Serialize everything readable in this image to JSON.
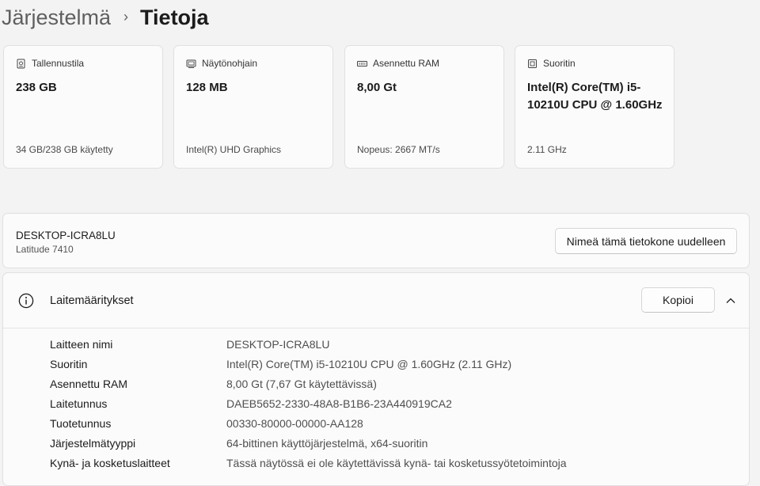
{
  "breadcrumb": {
    "parent": "Järjestelmä",
    "separator": "›",
    "current": "Tietoja"
  },
  "cards": [
    {
      "icon": "storage-icon",
      "title": "Tallennustila",
      "value": "238 GB",
      "sub": "34 GB/238 GB käytetty"
    },
    {
      "icon": "display-adapter-icon",
      "title": "Näytönohjain",
      "value": "128 MB",
      "sub": "Intel(R) UHD Graphics"
    },
    {
      "icon": "ram-icon",
      "title": "Asennettu RAM",
      "value": "8,00 Gt",
      "sub": "Nopeus: 2667 MT/s"
    },
    {
      "icon": "processor-icon",
      "title": "Suoritin",
      "value": "Intel(R) Core(TM) i5-10210U CPU @ 1.60GHz",
      "sub": "2.11 GHz"
    }
  ],
  "device": {
    "name": "DESKTOP-ICRA8LU",
    "model": "Latitude 7410",
    "rename_label": "Nimeä tämä tietokone uudelleen"
  },
  "specs": {
    "title": "Laitemääritykset",
    "copy_label": "Kopioi",
    "rows": [
      {
        "label": "Laitteen nimi",
        "value": "DESKTOP-ICRA8LU"
      },
      {
        "label": "Suoritin",
        "value": "Intel(R) Core(TM) i5-10210U CPU @ 1.60GHz (2.11 GHz)"
      },
      {
        "label": "Asennettu RAM",
        "value": "8,00 Gt (7,67 Gt käytettävissä)"
      },
      {
        "label": "Laitetunnus",
        "value": "DAEB5652-2330-48A8-B1B6-23A440919CA2"
      },
      {
        "label": "Tuotetunnus",
        "value": "00330-80000-00000-AA128"
      },
      {
        "label": "Järjestelmätyyppi",
        "value": "64-bittinen käyttöjärjestelmä, x64-suoritin"
      },
      {
        "label": "Kynä- ja kosketuslaitteet",
        "value": "Tässä näytössä ei ole käytettävissä kynä- tai kosketussyötetoimintoja"
      }
    ]
  }
}
